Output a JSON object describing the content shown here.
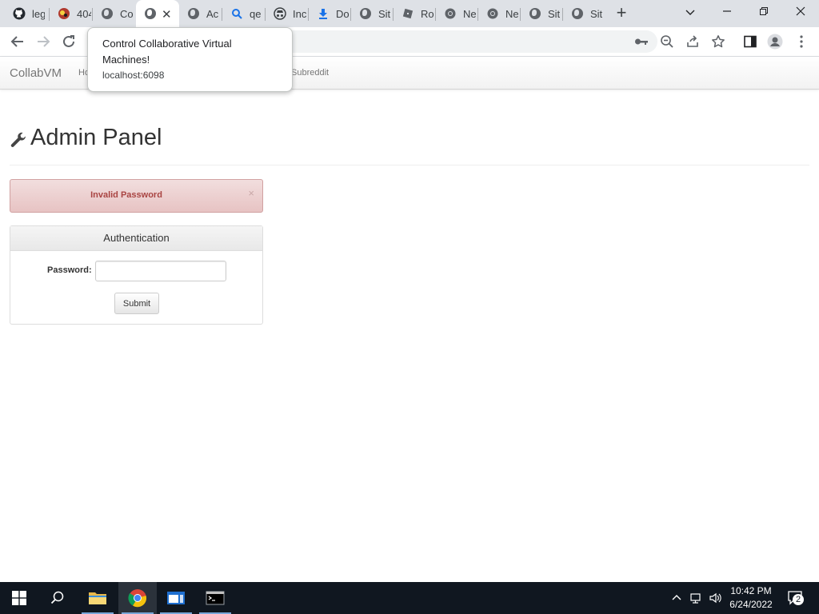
{
  "browser": {
    "tabs": [
      {
        "title": "leg",
        "icon": "github-icon"
      },
      {
        "title": "404",
        "icon": "site-favicon-icon"
      },
      {
        "title": "Co",
        "icon": "globe-icon"
      },
      {
        "title": "",
        "icon": "globe-icon",
        "active": true
      },
      {
        "title": "Ac",
        "icon": "globe-icon"
      },
      {
        "title": "qe",
        "icon": "search-icon"
      },
      {
        "title": "Inc",
        "icon": "incognito-icon"
      },
      {
        "title": "Do",
        "icon": "download-icon"
      },
      {
        "title": "Sit",
        "icon": "globe-icon"
      },
      {
        "title": "Ro",
        "icon": "roblox-icon"
      },
      {
        "title": "Ne",
        "icon": "chrome-icon"
      },
      {
        "title": "Ne",
        "icon": "chrome-icon"
      },
      {
        "title": "Sit",
        "icon": "globe-icon"
      },
      {
        "title": "Sit",
        "icon": "globe-icon"
      }
    ],
    "tooltip": {
      "title": "Control Collaborative Virtual Machines!",
      "url": "localhost:6098"
    }
  },
  "site": {
    "brand": "CollabVM",
    "nav": {
      "home_partial": "Ho",
      "subreddit": "Subreddit"
    }
  },
  "page": {
    "heading": "Admin Panel",
    "alert": {
      "text": "Invalid Password",
      "close": "×"
    },
    "auth": {
      "title": "Authentication",
      "password_label": "Password:",
      "password_value": "",
      "submit_label": "Submit"
    }
  },
  "taskbar": {
    "time": "10:42 PM",
    "date": "6/24/2022",
    "notification_count": "2"
  },
  "colors": {
    "alert_bg": "#f2dede",
    "alert_text": "#a94442",
    "taskbar_bg": "#101720",
    "tabstrip_bg": "#dee1e6"
  }
}
